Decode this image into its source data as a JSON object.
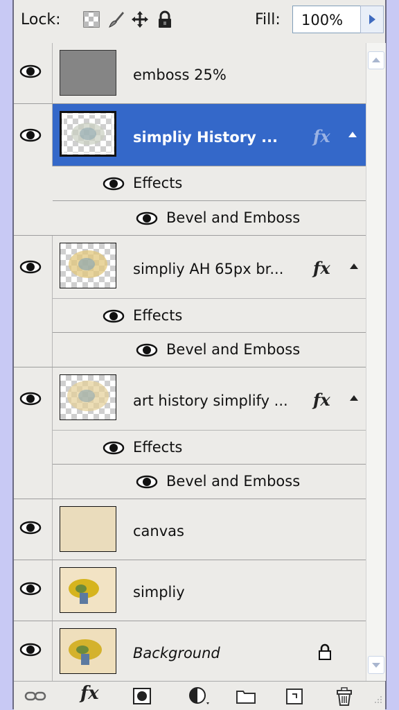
{
  "lockbar": {
    "lock_label": "Lock:",
    "fill_label": "Fill:",
    "fill_value": "100%",
    "lock_icons": [
      "lock-transparent-pixels-icon",
      "lock-image-pixels-icon",
      "lock-position-icon",
      "lock-all-icon"
    ]
  },
  "layers": [
    {
      "name": "emboss 25%"
    },
    {
      "name": "simpliy History ...",
      "fx": "fx",
      "selected": true,
      "effects_label": "Effects",
      "effect": "Bevel and Emboss"
    },
    {
      "name": "simpliy AH 65px br...",
      "fx": "fx",
      "effects_label": "Effects",
      "effect": "Bevel and Emboss"
    },
    {
      "name": "art history simplify ...",
      "fx": "fx",
      "effects_label": "Effects",
      "effect": "Bevel and Emboss"
    },
    {
      "name": "canvas"
    },
    {
      "name": "simpliy"
    },
    {
      "name": "Background",
      "locked": true
    }
  ],
  "bottom_bar": {
    "fx_label": "fx",
    "icons": [
      "link-layers-icon",
      "layer-style-icon",
      "add-mask-icon",
      "adjustment-layer-icon",
      "new-group-icon",
      "new-layer-icon",
      "delete-layer-icon"
    ]
  },
  "colors": {
    "selection": "#3468c9",
    "panel": "#ecebe8",
    "frame": "#c8c9f4"
  }
}
